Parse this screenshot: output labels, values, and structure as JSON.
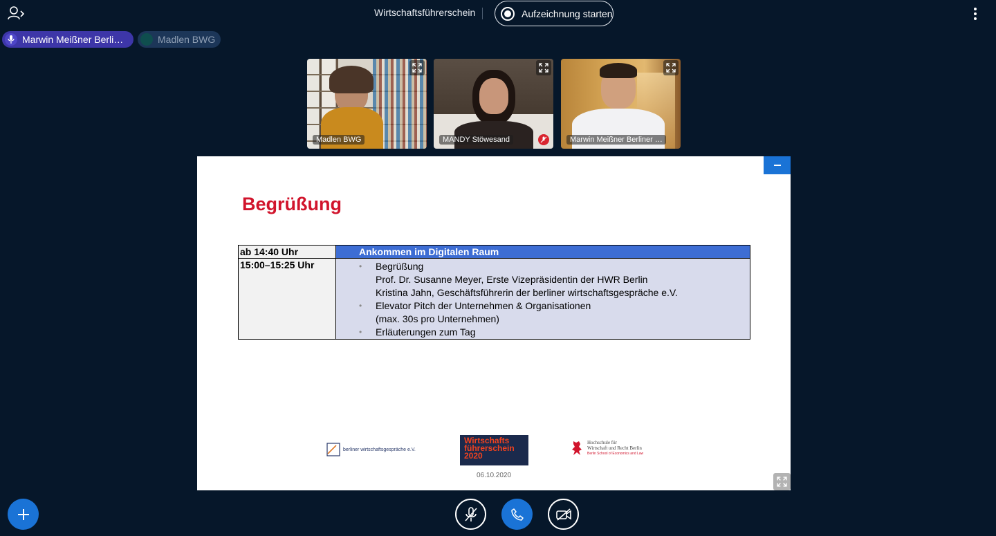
{
  "header": {
    "meeting_title": "Wirtschaftsführerschein",
    "record_label": "Aufzeichnung starten"
  },
  "talking": [
    {
      "name": "Marwin Meißner Berli…",
      "active": true
    },
    {
      "name": "Madlen BWG",
      "active": false
    }
  ],
  "videos": [
    {
      "name": "Madlen BWG",
      "muted": false
    },
    {
      "name": "MANDY Stöwesand",
      "muted": true
    },
    {
      "name": "Marwin Meißner Berliner …",
      "muted": false
    }
  ],
  "slide": {
    "title": "Begrüßung",
    "rows": [
      {
        "time": "ab 14:40 Uhr",
        "header": "Ankommen im Digitalen Raum"
      },
      {
        "time": "15:00–15:25 Uhr",
        "items": [
          {
            "text": "Begrüßung",
            "bullet": true
          },
          {
            "text": "Prof. Dr. Susanne Meyer, Erste Vizepräsidentin der HWR Berlin",
            "bullet": false
          },
          {
            "text": "Kristina Jahn, Geschäftsführerin der berliner wirtschaftsgespräche e.V.",
            "bullet": false
          },
          {
            "text": "Elevator Pitch der Unternehmen & Organisationen",
            "bullet": true
          },
          {
            "text": "(max. 30s pro Unternehmen)",
            "bullet": false
          },
          {
            "text": "Erläuterungen zum Tag",
            "bullet": true
          }
        ]
      }
    ],
    "logos": {
      "bwg": "berliner wirtschaftsgespräche e.V.",
      "wfs": [
        "Wirtschafts",
        "führerschein",
        "2020"
      ],
      "hwr": [
        "Hochschule für",
        "Wirtschaft und Recht Berlin",
        "Berlin School of Economics and Law"
      ]
    },
    "date": "06.10.2020"
  },
  "colors": {
    "background": "#06172a",
    "accent": "#1a73d6",
    "talker_active": "#3d36a8",
    "slide_title": "#d1142c",
    "table_header": "#3d6dd4"
  },
  "icons": {
    "users": "user-list-icon",
    "record": "record-icon",
    "menu": "more-vertical-icon",
    "mic": "microphone-muted-icon",
    "phone": "phone-icon",
    "camera": "video-off-icon",
    "add": "plus-icon",
    "expand": "expand-icon",
    "minimize": "minimize-icon"
  }
}
